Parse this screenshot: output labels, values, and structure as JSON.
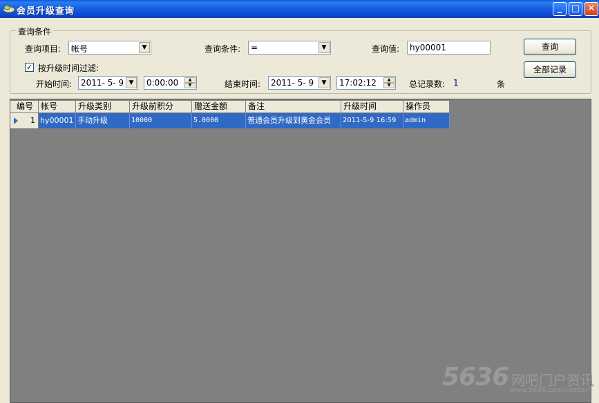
{
  "window": {
    "title": "会员升级查询",
    "min_label": "_",
    "max_label": "□",
    "close_label": "✕"
  },
  "query_group": {
    "legend": "查询条件",
    "item_label": "查询项目:",
    "item_value": "帐号",
    "condition_label": "查询条件:",
    "condition_value": "=",
    "value_label": "查询值:",
    "value_text": "hy00001",
    "filter_label": "按升级时间过滤:",
    "filter_checked": true,
    "start_label": "开始时间:",
    "start_date": "2011- 5- 9",
    "start_time": "0:00:00",
    "end_label": "结束时间:",
    "end_date": "2011- 5- 9",
    "end_time": "17:02:12",
    "total_label": "总记录数:",
    "total_count": "1",
    "total_unit": "条",
    "query_button": "查询",
    "all_button": "全部记录"
  },
  "table": {
    "columns": [
      "编号",
      "帐号",
      "升级类别",
      "升级前积分",
      "赠送金额",
      "备注",
      "升级时间",
      "操作员"
    ],
    "rows": [
      [
        "1",
        "hy00001",
        "手动升级",
        "10000",
        "5.0000",
        "普通会员升级到黄金会员",
        "2011-5-9 16:59",
        "admin"
      ]
    ]
  },
  "watermark": {
    "brand": "5636",
    "brand_cn": "网吧门户资讯",
    "url": "www.5636.com/netbar/"
  },
  "colors": {
    "title_bar": "#0a5bd6",
    "selection": "#316ac5",
    "grid_bg": "#808080",
    "window_bg": "#ece9d8"
  }
}
